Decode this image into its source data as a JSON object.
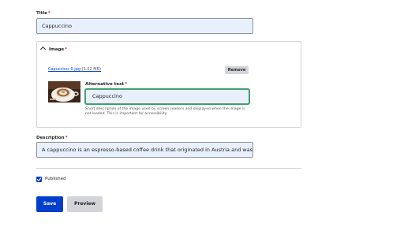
{
  "title_field": {
    "label": "Title",
    "required_mark": "*",
    "value": "Cappuccino"
  },
  "image_field": {
    "label": "Image",
    "required_mark": "*",
    "file_name": "Capuccino_0.jpg",
    "file_size": "(5.02 MB)",
    "remove_label": "Remove",
    "alt_text": {
      "label": "Alternative text",
      "required_mark": "*",
      "value": "Cappuccino",
      "help_line1": "Short description of the image used by screen readers and displayed when the image is",
      "help_line2": "not loaded. This is important for accessibility."
    }
  },
  "description_field": {
    "label": "Description",
    "required_mark": "*",
    "value": "A cappuccino is an espresso-based coffee drink that originated in Austria and was later po"
  },
  "published": {
    "label": "Published",
    "checked": true
  },
  "actions": {
    "save_label": "Save",
    "preview_label": "Preview"
  },
  "colors": {
    "primary": "#003ecc",
    "input_bg": "#e9f0fd",
    "required": "#d72222",
    "focus": "#26a769"
  }
}
